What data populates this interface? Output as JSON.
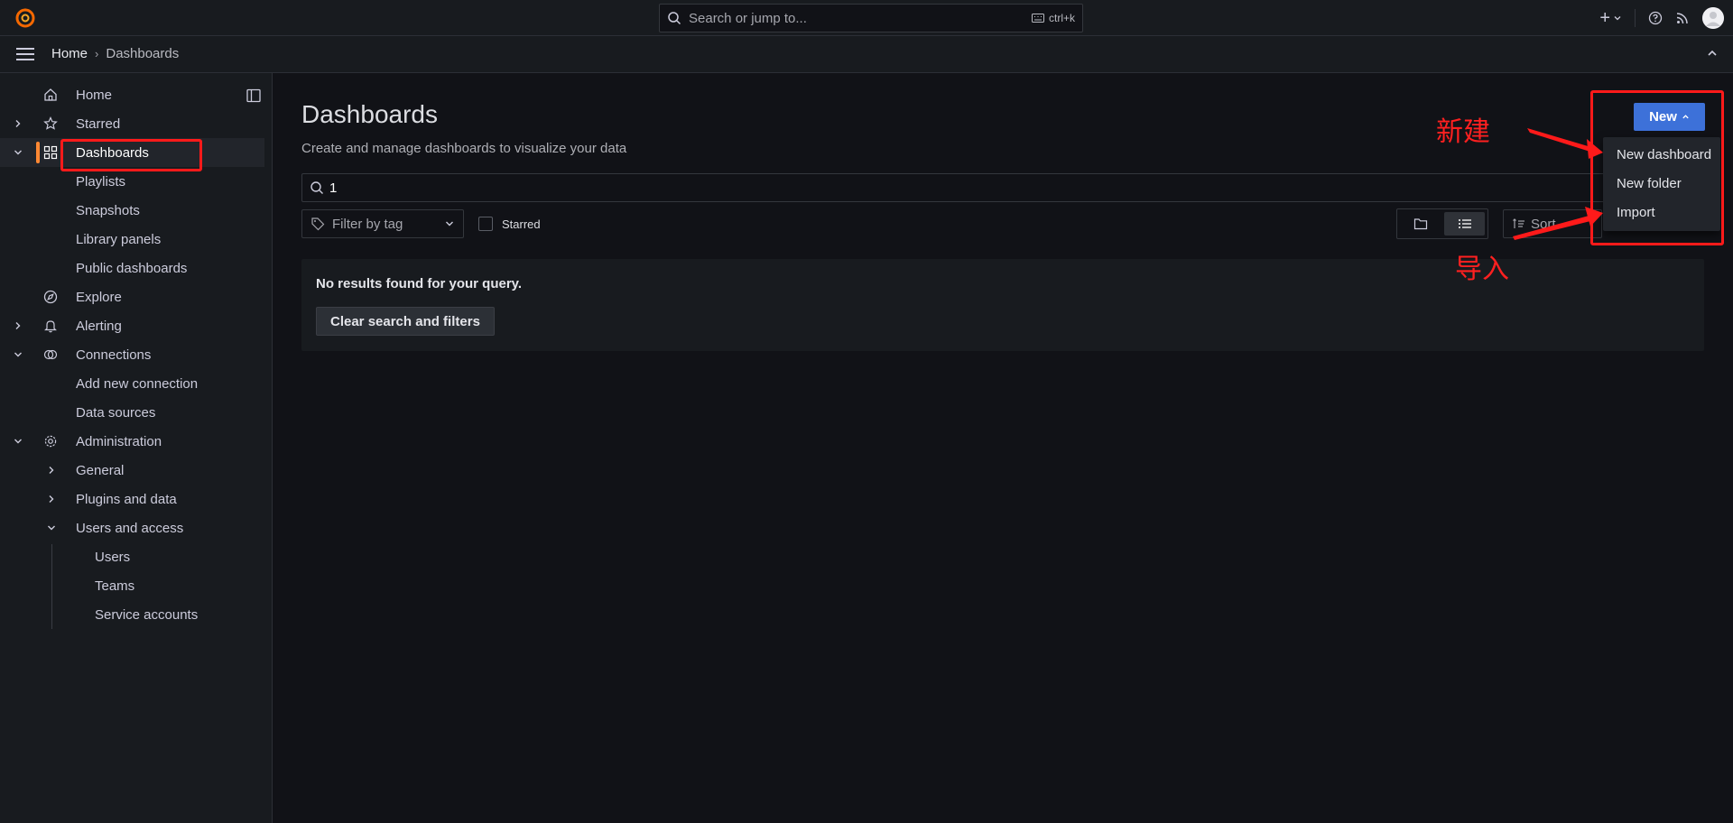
{
  "topbar": {
    "search_placeholder": "Search or jump to...",
    "shortcut": "ctrl+k",
    "add_label": "+",
    "icons": [
      "grafana-logo-icon",
      "search-icon",
      "keyboard-icon",
      "plus-icon",
      "help-icon",
      "rss-icon",
      "avatar"
    ]
  },
  "breadcrumb": {
    "home": "Home",
    "separator": "›",
    "current": "Dashboards"
  },
  "sidebar": {
    "items": [
      {
        "label": "Home",
        "icon": "home-icon"
      },
      {
        "label": "Starred",
        "icon": "star-icon"
      },
      {
        "label": "Dashboards",
        "icon": "apps-icon",
        "active": true
      },
      {
        "label": "Playlists"
      },
      {
        "label": "Snapshots"
      },
      {
        "label": "Library panels"
      },
      {
        "label": "Public dashboards"
      },
      {
        "label": "Explore",
        "icon": "compass-icon"
      },
      {
        "label": "Alerting",
        "icon": "bell-icon"
      },
      {
        "label": "Connections",
        "icon": "connections-icon"
      },
      {
        "label": "Add new connection"
      },
      {
        "label": "Data sources"
      },
      {
        "label": "Administration",
        "icon": "gear-icon"
      },
      {
        "label": "General"
      },
      {
        "label": "Plugins and data"
      },
      {
        "label": "Users and access"
      },
      {
        "label": "Users"
      },
      {
        "label": "Teams"
      },
      {
        "label": "Service accounts"
      }
    ]
  },
  "main": {
    "title": "Dashboards",
    "subtitle": "Create and manage dashboards to visualize your data",
    "query_value": "1",
    "tag_filter_placeholder": "Filter by tag",
    "starred_label": "Starred",
    "sort_label": "Sort",
    "no_results": "No results found for your query.",
    "clear_button": "Clear search and filters"
  },
  "new_menu": {
    "button_label": "New",
    "items": [
      "New dashboard",
      "New folder",
      "Import"
    ]
  },
  "annotations": {
    "new_label": "新建",
    "import_label": "导入",
    "color": "#ff1a1a"
  },
  "colors": {
    "accent": "#ff8833",
    "primary": "#3d71d9",
    "background": "#111217",
    "panel": "#181b1f"
  }
}
